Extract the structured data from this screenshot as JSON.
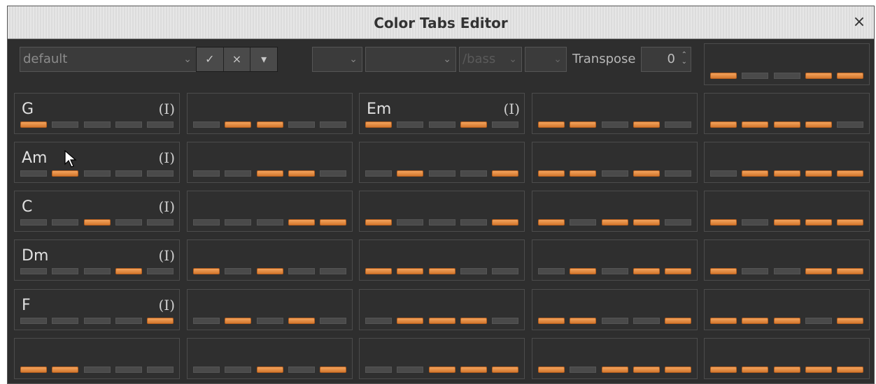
{
  "window": {
    "title": "Color Tabs Editor",
    "close_glyph": "×"
  },
  "toolbar": {
    "preset_value": "default",
    "chevron": "⌄",
    "buttons": [
      {
        "name": "confirm-button",
        "glyph": "✓"
      },
      {
        "name": "cancel-button",
        "glyph": "×"
      },
      {
        "name": "menu-button",
        "glyph": "▾"
      }
    ],
    "root_select_value": "",
    "type_select_value": "",
    "bass_select_value": "/bass",
    "extra_select_value": "",
    "transpose_label": "Transpose",
    "transpose_value": "0",
    "transpose_arrows": "⌃⌄"
  },
  "colors": {
    "accent": "#e88c43",
    "background": "#2e2e2e"
  },
  "grid": [
    [
      {
        "chord": "",
        "flag": "",
        "strings": [
          1,
          0,
          0,
          1,
          1
        ],
        "header_preview": true
      }
    ],
    [
      {
        "chord": "G",
        "flag": "(I)",
        "strings": [
          1,
          0,
          0,
          0,
          0
        ]
      },
      {
        "chord": "",
        "flag": "",
        "strings": [
          0,
          1,
          1,
          0,
          0
        ]
      },
      {
        "chord": "Em",
        "flag": "(I)",
        "strings": [
          1,
          0,
          0,
          1,
          0
        ]
      },
      {
        "chord": "",
        "flag": "",
        "strings": [
          1,
          1,
          0,
          1,
          0
        ]
      },
      {
        "chord": "",
        "flag": "",
        "strings": [
          1,
          1,
          1,
          1,
          0
        ]
      }
    ],
    [
      {
        "chord": "Am",
        "flag": "(I)",
        "strings": [
          0,
          1,
          0,
          0,
          0
        ]
      },
      {
        "chord": "",
        "flag": "",
        "strings": [
          0,
          0,
          1,
          1,
          0
        ]
      },
      {
        "chord": "",
        "flag": "",
        "strings": [
          0,
          1,
          0,
          0,
          1
        ]
      },
      {
        "chord": "",
        "flag": "",
        "strings": [
          1,
          1,
          0,
          1,
          0
        ]
      },
      {
        "chord": "",
        "flag": "",
        "strings": [
          0,
          1,
          1,
          1,
          1
        ]
      }
    ],
    [
      {
        "chord": "C",
        "flag": "(I)",
        "strings": [
          0,
          0,
          1,
          0,
          0
        ]
      },
      {
        "chord": "",
        "flag": "",
        "strings": [
          0,
          0,
          0,
          1,
          1
        ]
      },
      {
        "chord": "",
        "flag": "",
        "strings": [
          1,
          0,
          0,
          0,
          1
        ]
      },
      {
        "chord": "",
        "flag": "",
        "strings": [
          1,
          0,
          1,
          1,
          0
        ]
      },
      {
        "chord": "",
        "flag": "",
        "strings": [
          1,
          0,
          1,
          1,
          1
        ]
      }
    ],
    [
      {
        "chord": "Dm",
        "flag": "(I)",
        "strings": [
          0,
          0,
          0,
          1,
          0
        ]
      },
      {
        "chord": "",
        "flag": "",
        "strings": [
          1,
          0,
          1,
          0,
          0
        ]
      },
      {
        "chord": "",
        "flag": "",
        "strings": [
          1,
          1,
          1,
          0,
          0
        ]
      },
      {
        "chord": "",
        "flag": "",
        "strings": [
          0,
          1,
          0,
          1,
          1
        ]
      },
      {
        "chord": "",
        "flag": "",
        "strings": [
          1,
          0,
          0,
          1,
          1
        ]
      }
    ],
    [
      {
        "chord": "F",
        "flag": "(I)",
        "strings": [
          0,
          0,
          0,
          0,
          1
        ]
      },
      {
        "chord": "",
        "flag": "",
        "strings": [
          0,
          1,
          0,
          1,
          0
        ]
      },
      {
        "chord": "",
        "flag": "",
        "strings": [
          0,
          1,
          1,
          1,
          0
        ]
      },
      {
        "chord": "",
        "flag": "",
        "strings": [
          1,
          1,
          0,
          0,
          1
        ]
      },
      {
        "chord": "",
        "flag": "",
        "strings": [
          1,
          1,
          1,
          0,
          1
        ]
      }
    ],
    [
      {
        "chord": "",
        "flag": "",
        "strings": [
          1,
          1,
          0,
          0,
          0
        ]
      },
      {
        "chord": "",
        "flag": "",
        "strings": [
          0,
          0,
          1,
          0,
          1
        ]
      },
      {
        "chord": "",
        "flag": "",
        "strings": [
          0,
          0,
          1,
          1,
          1
        ]
      },
      {
        "chord": "",
        "flag": "",
        "strings": [
          1,
          0,
          1,
          1,
          1
        ]
      },
      {
        "chord": "",
        "flag": "",
        "strings": [
          1,
          1,
          1,
          1,
          1
        ]
      }
    ]
  ]
}
